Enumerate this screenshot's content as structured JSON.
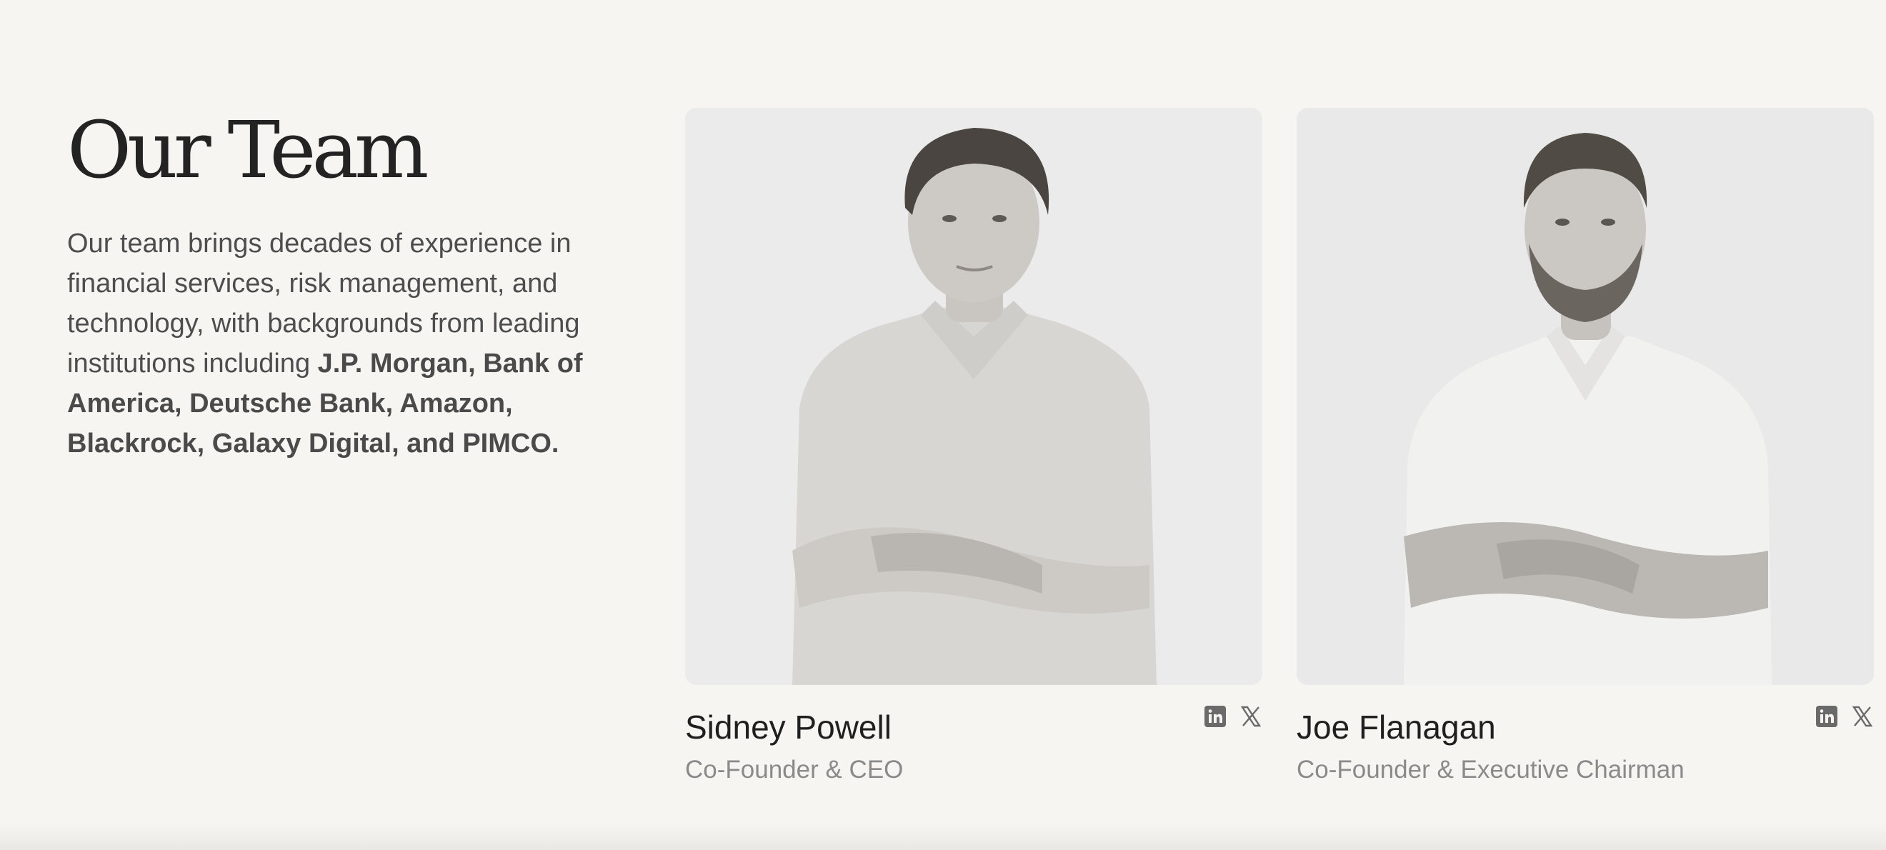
{
  "section": {
    "title": "Our Team",
    "description_plain": "Our team brings decades of experience in financial services, risk management, and technology, with backgrounds from leading institutions including ",
    "description_bold": "J.P. Morgan, Bank of America, Deutsche Bank, Amazon, Blackrock, Galaxy Digital, and PIMCO."
  },
  "members": [
    {
      "name": "Sidney Powell",
      "role": "Co-Founder & CEO",
      "social_icons": [
        "linkedin-icon",
        "x-icon"
      ]
    },
    {
      "name": "Joe Flanagan",
      "role": "Co-Founder & Executive Chairman",
      "social_icons": [
        "linkedin-icon",
        "x-icon"
      ]
    }
  ],
  "colors": {
    "background": "#f6f5f2",
    "heading": "#232323",
    "body_text": "#4d4d4d",
    "role_text": "#8a8a8a",
    "icon": "#6a6a6a"
  }
}
